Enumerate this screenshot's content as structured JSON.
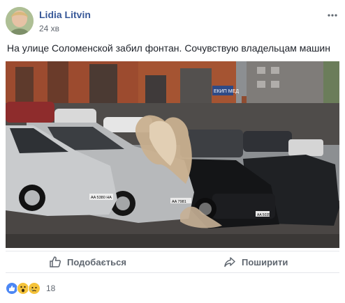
{
  "post": {
    "author": "Lidia Litvin",
    "timestamp": "24 хв",
    "text": "На улице Соломенской забил фонтан. Сочувствую владельцам машин",
    "more_icon": "more-horizontal-icon"
  },
  "photo": {
    "plate_left": "AA 5380 HA",
    "plate_mid": "AA 7981",
    "plate_right": "AA 5035",
    "sign_text": "ЕКИП МЕД"
  },
  "actions": {
    "like_label": "Подобається",
    "share_label": "Поширити",
    "like_icon": "thumbs-up-icon",
    "share_icon": "share-arrow-icon"
  },
  "reactions": {
    "types": [
      "like",
      "wow",
      "sad"
    ],
    "count": "18"
  },
  "colors": {
    "author": "#385898",
    "muted": "#616770",
    "action": "#606770",
    "like_blue": "#4c87f4",
    "emoji_yellow": "#f5c33b"
  }
}
